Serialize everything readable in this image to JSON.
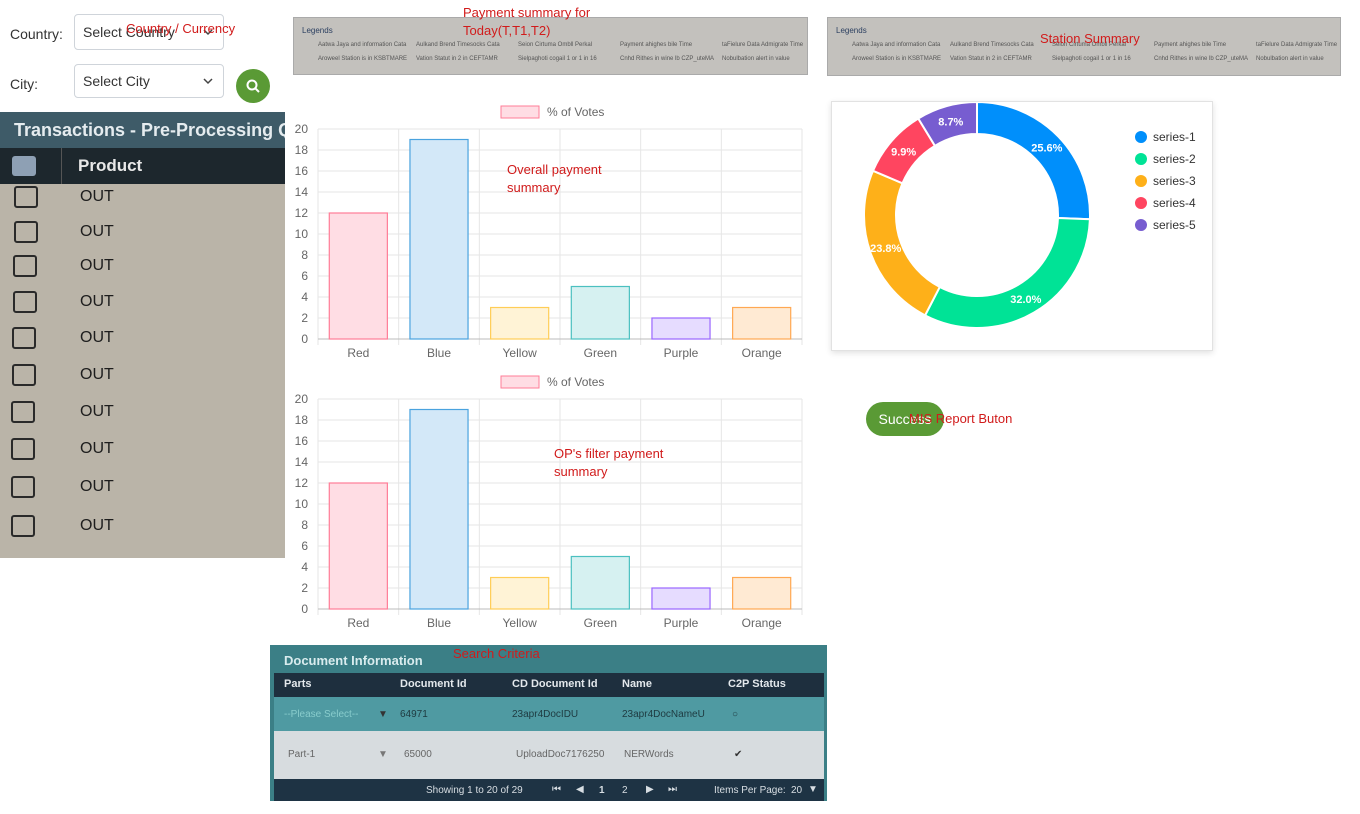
{
  "filters": {
    "country_label": "Country:",
    "country_select": "Select Country",
    "city_label": "City:",
    "city_select": "Select City"
  },
  "annotations": {
    "country_currency": "Country / Currency",
    "payment_summary_line1": "Payment summary for",
    "payment_summary_line2": "Today(T,T1,T2)",
    "station_summary": "Station Summary",
    "overall_payment_line1": "Overall payment",
    "overall_payment_line2": "summary",
    "op_filter_line1": "OP's filter payment",
    "op_filter_line2": "summary",
    "mis_report": "MIS Report Buton",
    "search_criteria": "Search Criteria"
  },
  "transactions": {
    "title": "Transactions - Pre-Processing Q",
    "column": "Product",
    "rows": [
      "OUT",
      "OUT",
      "OUT",
      "OUT",
      "OUT",
      "OUT",
      "OUT",
      "OUT",
      "OUT",
      "OUT"
    ]
  },
  "legend_strips": {
    "title": "Legends",
    "items": [
      "Aatwa Jaya and information Cata",
      "Aroweel Station is in KSBTMARE",
      "Aulkand Brend Timesocks Cata",
      "Vation Statut in 2 in CEFTAMR",
      "Seion Cirtuma Ombll Perkal",
      "Sielpaghoti cogail 1 or 1 in 16",
      "Payment ahighes bile Time",
      "Cnhd Rithes in wine lb CZP_uteMA",
      "taFielure Data Admigrate Time",
      "Nobulbation alert in value"
    ]
  },
  "bar_chart_1": {
    "chart_data": {
      "type": "bar",
      "categories": [
        "Red",
        "Blue",
        "Yellow",
        "Green",
        "Purple",
        "Orange"
      ],
      "series": [
        {
          "name": "% of Votes",
          "values": [
            12,
            19,
            3,
            5,
            2,
            3
          ]
        }
      ],
      "ylim": [
        0,
        20
      ],
      "yticks": [
        0,
        2,
        4,
        6,
        8,
        10,
        12,
        14,
        16,
        18,
        20
      ],
      "legend": "top",
      "grid": true,
      "colors": {
        "fill": [
          "#ffdde4",
          "#d3e8f8",
          "#fff3d6",
          "#d6f1f1",
          "#e6dcff",
          "#ffead3"
        ],
        "stroke": [
          "#ff7d97",
          "#4aa3df",
          "#ffcd56",
          "#4bc0c0",
          "#9966ff",
          "#ffa852"
        ]
      }
    }
  },
  "bar_chart_2": {
    "chart_data": {
      "type": "bar",
      "categories": [
        "Red",
        "Blue",
        "Yellow",
        "Green",
        "Purple",
        "Orange"
      ],
      "series": [
        {
          "name": "% of Votes",
          "values": [
            12,
            19,
            3,
            5,
            2,
            3
          ]
        }
      ],
      "ylim": [
        0,
        20
      ],
      "yticks": [
        0,
        2,
        4,
        6,
        8,
        10,
        12,
        14,
        16,
        18,
        20
      ],
      "legend": "top",
      "grid": true,
      "colors": {
        "fill": [
          "#ffdde4",
          "#d3e8f8",
          "#fff3d6",
          "#d6f1f1",
          "#e6dcff",
          "#ffead3"
        ],
        "stroke": [
          "#ff7d97",
          "#4aa3df",
          "#ffcd56",
          "#4bc0c0",
          "#9966ff",
          "#ffa852"
        ]
      }
    }
  },
  "donut_chart": {
    "chart_data": {
      "type": "pie",
      "categories": [
        "series-1",
        "series-2",
        "series-3",
        "series-4",
        "series-5"
      ],
      "values": [
        25.6,
        32.0,
        23.8,
        9.9,
        8.7
      ],
      "labels": [
        "25.6%",
        "32.0%",
        "23.8%",
        "9.9%",
        "8.7%"
      ],
      "legend": "right",
      "colors": [
        "#008ffb",
        "#00e396",
        "#feb019",
        "#ff4560",
        "#775dd0"
      ]
    }
  },
  "success_button": "Success",
  "document_info": {
    "title": "Document Information",
    "columns": [
      "Parts",
      "Document Id",
      "CD Document Id",
      "Name",
      "C2P Status"
    ],
    "rows": [
      [
        "--Please Select--",
        "64971",
        "23apr4DocIDU",
        "23apr4DocNameU",
        "○"
      ],
      [
        "Part-1",
        "65000",
        "UploadDoc7176250",
        "NERWords",
        "✔"
      ]
    ],
    "footer": {
      "showing": "Showing 1 to 20 of 29",
      "pages": [
        "1",
        "2"
      ],
      "items_per_page_label": "Items Per Page:",
      "items_per_page_value": "20"
    }
  }
}
